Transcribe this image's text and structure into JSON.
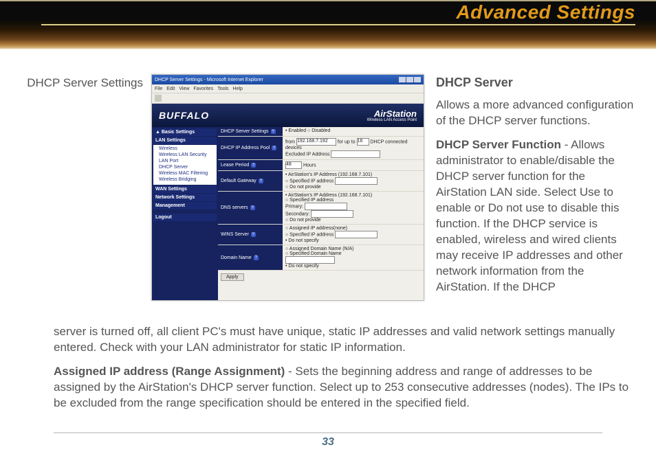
{
  "page": {
    "title": "Advanced Settings",
    "caption": "DHCP Server Settings",
    "page_number": "33"
  },
  "shot": {
    "window_title": "DHCP Server Settings - Microsoft Internet Explorer",
    "menus": [
      "File",
      "Edit",
      "View",
      "Favorites",
      "Tools",
      "Help"
    ],
    "brand": "BUFFALO",
    "product": "AirStation",
    "product_sub": "Wireless LAN Access Point",
    "side": {
      "basic": "▲ Basic Settings",
      "lan_hdr": "LAN Settings",
      "lan_items": [
        "Wireless",
        "Wireless LAN Security",
        "LAN Port",
        "DHCP Server",
        "Wireless MAC Filtering",
        "Wireless Bridging"
      ],
      "wan_hdr": "WAN Settings",
      "net_hdr": "Network Settings",
      "mgmt_hdr": "Management",
      "logout": "Logout"
    },
    "rows": {
      "dhcp_fn_lbl": "DHCP Server Settings",
      "dhcp_fn_val": "• Enabled  ○ Disabled",
      "pool_lbl": "DHCP IP Address Pool",
      "pool_from_lbl": "from",
      "pool_from_val": "192.168.7.192",
      "pool_upto_lbl": "for up to",
      "pool_upto_val": "16",
      "pool_tail": "DHCP connected devices",
      "pool_line2": "Excluded IP Address",
      "lease_lbl": "Lease Period",
      "lease_val": "48",
      "lease_tail": "Hours",
      "gw_lbl": "Default Gateway",
      "gw_o1": "• AirStation's IP Address (192.168.7.101)",
      "gw_o2": "○ Specified IP address",
      "gw_o3": "○ Do not provide",
      "dns_lbl": "DNS servers",
      "dns_o1": "• AirStation's IP Address (192.168.7.101)",
      "dns_o2": "○ Specified IP address",
      "dns_p": "Primary:",
      "dns_s": "Secondary:",
      "dns_o3": "○ Do not provide",
      "wins_lbl": "WINS Server",
      "wins_o1": "○ Assigned IP address(none)",
      "wins_o2": "○ Specified IP address",
      "wins_o3": "• Do not specify",
      "dom_lbl": "Domain Name",
      "dom_o1": "○ Assigned Domain Name (N/A)",
      "dom_o2": "○ Specified Domain Name",
      "dom_o3": "• Do not specify",
      "apply": "Apply"
    }
  },
  "text": {
    "h": "DHCP Server",
    "p1": "Allows a more advanced con­figuration of the DHCP server functions.",
    "p2a": "DHCP Server Function",
    "p2b": " - Al­lows administrator to enable/disable the DHCP server func­tion for the AirStation LAN side. Select Use to enable or Do not use to disable this function.  If the DHCP service is enabled, wireless and wired clients may receive IP addresses and other network information from the AirStation.  If the DHCP",
    "p2c": "server is turned off, all client PC's must have unique, static IP addresses and valid network settings manually entered. Check with your LAN administrator for static IP information.",
    "p3a": "Assigned IP address (Range Assignment)",
    "p3b": " - Sets the beginning address and range of addresses to be assigned by the AirStation's DHCP server function.  Select up to 253 consecutive addresses (nodes).  The IPs to be excluded from the range specification should be entered in the specified field."
  }
}
